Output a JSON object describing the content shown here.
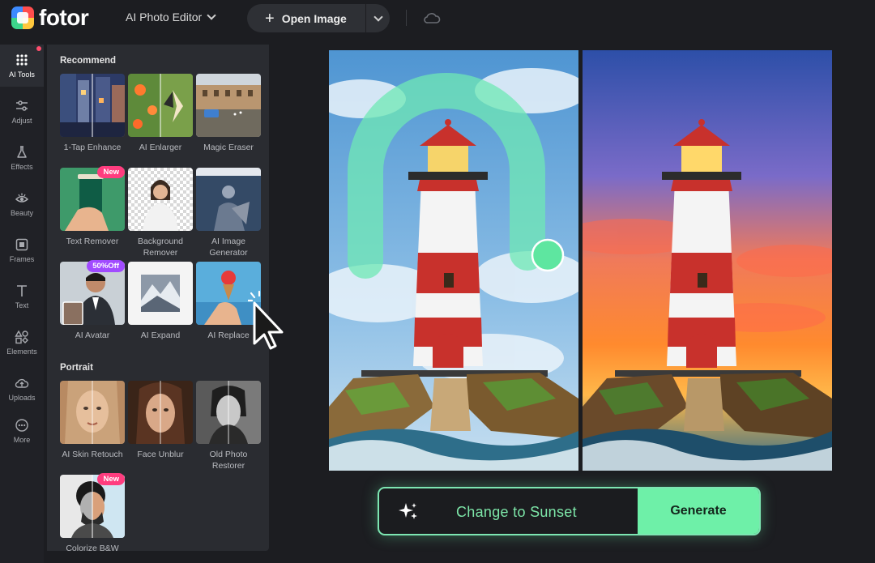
{
  "app": {
    "logo_text": "fotor",
    "editor_menu": "AI Photo Editor",
    "open_image": "Open Image"
  },
  "rail": {
    "items": [
      {
        "label": "AI Tools",
        "icon": "grid-icon"
      },
      {
        "label": "Adjust",
        "icon": "sliders-icon"
      },
      {
        "label": "Effects",
        "icon": "flask-icon"
      },
      {
        "label": "Beauty",
        "icon": "eye-icon"
      },
      {
        "label": "Frames",
        "icon": "frame-icon"
      },
      {
        "label": "Text",
        "icon": "text-icon"
      },
      {
        "label": "Elements",
        "icon": "shapes-icon"
      },
      {
        "label": "Uploads",
        "icon": "upload-icon"
      },
      {
        "label": "More",
        "icon": "more-icon"
      }
    ]
  },
  "panel": {
    "recommend_title": "Recommend",
    "portrait_title": "Portrait",
    "recommend": [
      {
        "label": "1-Tap Enhance"
      },
      {
        "label": "AI Enlarger"
      },
      {
        "label": "Magic Eraser"
      },
      {
        "label": "Text Remover",
        "badge": "New"
      },
      {
        "label": "Background Remover"
      },
      {
        "label": "AI Image Generator"
      },
      {
        "label": "AI Avatar",
        "badge": "50%Off"
      },
      {
        "label": "AI Expand"
      },
      {
        "label": "AI Replace"
      }
    ],
    "portrait": [
      {
        "label": "AI Skin Retouch"
      },
      {
        "label": "Face Unblur"
      },
      {
        "label": "Old Photo Restorer"
      },
      {
        "label": "Colorize B&W",
        "badge": "New"
      }
    ]
  },
  "prompt": {
    "text": "Change to Sunset",
    "generate": "Generate"
  },
  "colors": {
    "accent": "#6ef0a8",
    "badge_new": "#ff3d7f",
    "badge_off": "#a14bff",
    "panel_bg": "#2a2c31"
  }
}
